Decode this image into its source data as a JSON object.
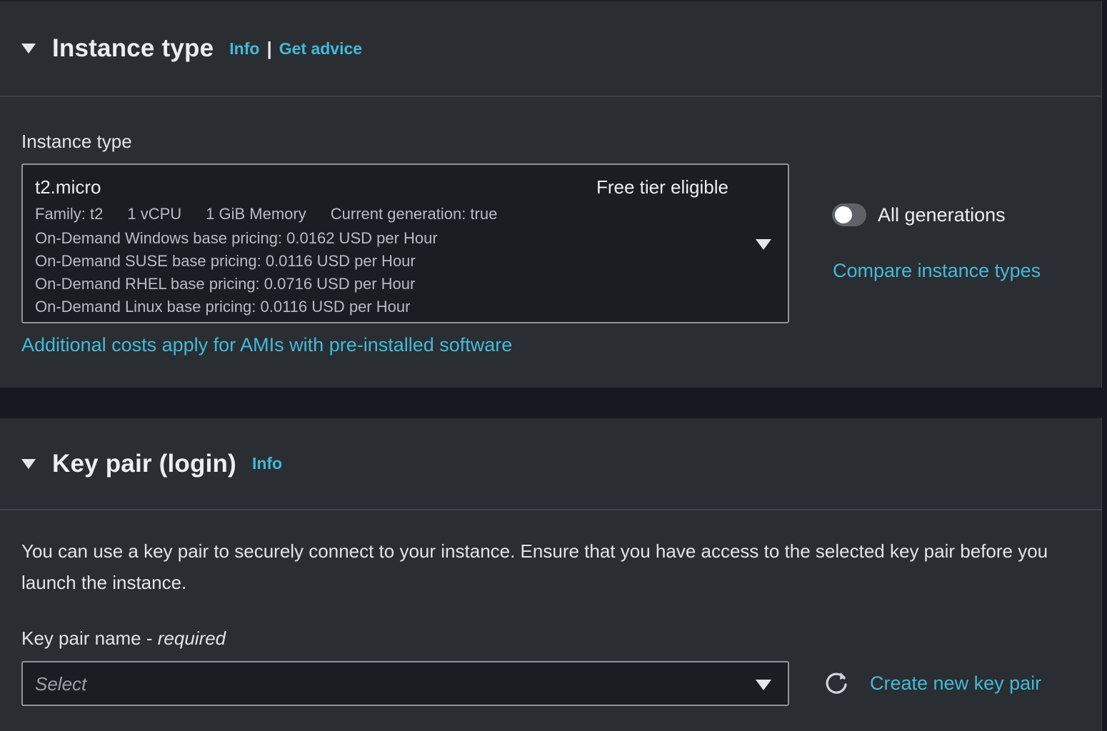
{
  "instance_section": {
    "title": "Instance type",
    "info_link": "Info",
    "separator": "|",
    "advice_link": "Get advice",
    "field_label": "Instance type",
    "selected": {
      "name": "t2.micro",
      "badge": "Free tier eligible",
      "family": "Family: t2",
      "vcpu": "1 vCPU",
      "memory": "1 GiB Memory",
      "generation": "Current generation: true",
      "pricing": [
        "On-Demand Windows base pricing: 0.0162 USD per Hour",
        "On-Demand SUSE base pricing: 0.0116 USD per Hour",
        "On-Demand RHEL base pricing: 0.0716 USD per Hour",
        "On-Demand Linux base pricing: 0.0116 USD per Hour"
      ]
    },
    "toggle_label": "All generations",
    "toggle_on": false,
    "compare_link": "Compare instance types",
    "costs_link": "Additional costs apply for AMIs with pre-installed software"
  },
  "keypair_section": {
    "title": "Key pair (login)",
    "info_link": "Info",
    "description": "You can use a key pair to securely connect to your instance. Ensure that you have access to the selected key pair before you launch the instance.",
    "field_label": "Key pair name - ",
    "field_required": "required",
    "placeholder": "Select",
    "create_link": "Create new key pair"
  },
  "colors": {
    "link": "#44b9d6",
    "panel": "#2a2e33",
    "input_bg": "#1a1d22"
  }
}
